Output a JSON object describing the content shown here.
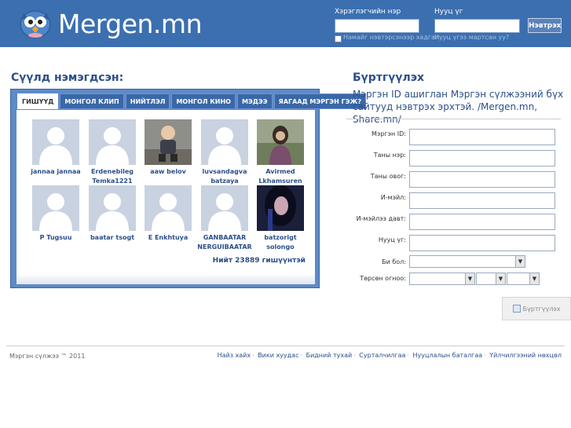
{
  "header": {
    "logo_text": "Mergen.mn",
    "username_label": "Хэрэглэгчийн нэр",
    "password_label": "Нууц үг",
    "username_value": "",
    "password_value": "",
    "login_button": "Нэвтрэх",
    "remember_label": "Намайг нэвтэрсэнээр хадгал",
    "forgot_label": "Нууц үгээ мартсан уу?",
    "colors": {
      "bar": "#3b6fb0"
    }
  },
  "recent": {
    "title": "Сүүлд нэмэгдсэн:",
    "tabs": [
      "ГИШҮҮД",
      "МОНГОЛ КЛИП",
      "НИЙТЛЭЛ",
      "МОНГОЛ КИНО",
      "МЭДЭЭ",
      "ЯАГААД МЭРГЭН ГЭЖ?"
    ],
    "members": [
      {
        "name": "jannaa jannaa",
        "photo": "silhouette"
      },
      {
        "name": "Erdenebileg Temka1221",
        "photo": "silhouette"
      },
      {
        "name": "aaw belov",
        "photo": "child-photo"
      },
      {
        "name": "luvsandagva batzaya",
        "photo": "silhouette"
      },
      {
        "name": "Avirmed Lkhamsuren",
        "photo": "woman-photo"
      },
      {
        "name": "P Tugsuu",
        "photo": "silhouette"
      },
      {
        "name": "baatar tsogt",
        "photo": "silhouette"
      },
      {
        "name": "E Enkhtuya",
        "photo": "silhouette"
      },
      {
        "name": "GANBAATAR NERGUIBAATAR",
        "photo": "silhouette"
      },
      {
        "name": "batzorigt solongo",
        "photo": "dark-hair-photo"
      }
    ],
    "total": "Нийт 23889 гишүүнтэй"
  },
  "register": {
    "title": "Бүртгүүлэх",
    "description": "Мэргэн ID ашиглан Мэргэн сүлжээний бүх сайтууд нэвтрэх эрхтэй. /Mergen.mn, Share.mn/",
    "fields": [
      {
        "label": "Мэргэн ID:",
        "value": ""
      },
      {
        "label": "Таны нэр:",
        "value": ""
      },
      {
        "label": "Таны овог:",
        "value": ""
      },
      {
        "label": "И-мэйл:",
        "value": ""
      },
      {
        "label": "И-мэйлээ давт:",
        "value": ""
      },
      {
        "label": "Нууц үг:",
        "value": ""
      }
    ],
    "gender_label": "Би бол:",
    "gender_value": "",
    "birthdate_label": "Төрсөн огноо:",
    "button": "Бүртгүүлэх"
  },
  "footer": {
    "copyright": "Мэргэн сүлжээ ™ 2011",
    "links": [
      "Найз хайх",
      "Вики хуудас",
      "Бидний тухай",
      "Сурталчилгаа",
      "Нууцлалын баталгаа",
      "Үйлчилгээний нөхцөл"
    ]
  }
}
